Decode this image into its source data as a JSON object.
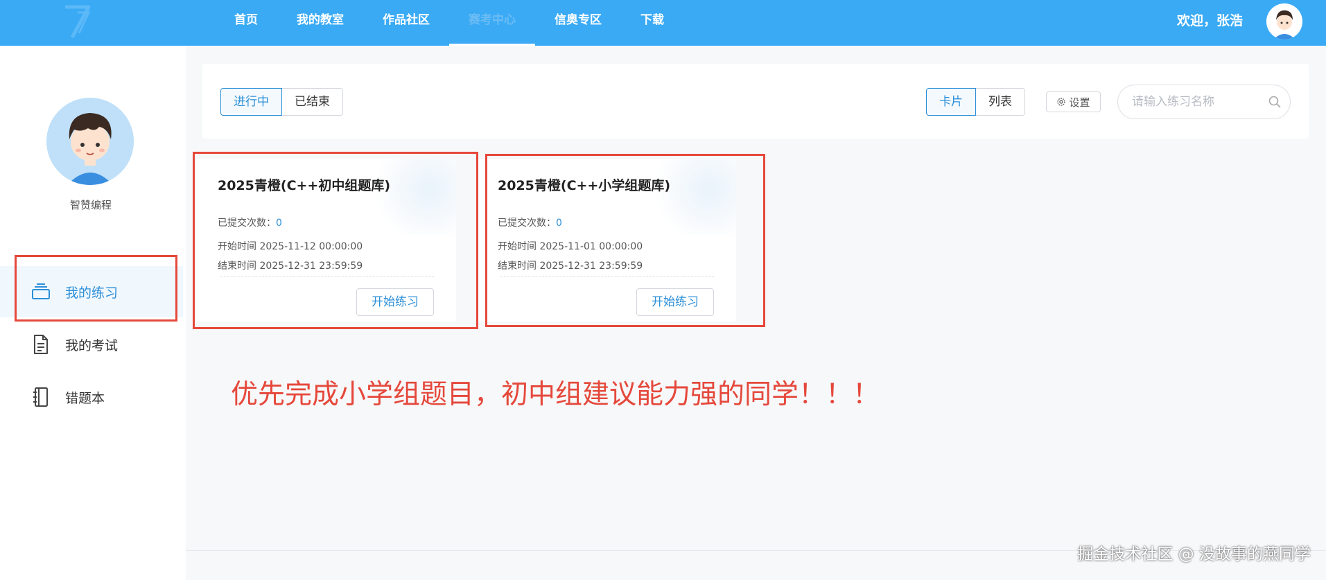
{
  "nav": {
    "items": [
      {
        "label": "首页",
        "active": false
      },
      {
        "label": "我的教室",
        "active": false
      },
      {
        "label": "作品社区",
        "active": false
      },
      {
        "label": "赛考中心",
        "active": true
      },
      {
        "label": "信奥专区",
        "active": false
      },
      {
        "label": "下载",
        "active": false
      }
    ],
    "welcome": "欢迎，张浩"
  },
  "sidebar": {
    "name": "智赞编程",
    "menu": [
      {
        "label": "我的练习",
        "icon": "stack-icon",
        "active": true
      },
      {
        "label": "我的考试",
        "icon": "document-icon",
        "active": false
      },
      {
        "label": "错题本",
        "icon": "notebook-icon",
        "active": false
      }
    ]
  },
  "toolbar": {
    "status_tabs": [
      "进行中",
      "已结束"
    ],
    "view_tabs": [
      "卡片",
      "列表"
    ],
    "settings_label": "设置",
    "search_placeholder": "请输入练习名称"
  },
  "cards": [
    {
      "title": "2025青橙(C++初中组题库)",
      "submit_label": "已提交次数：",
      "submit_count": "0",
      "start": "开始时间 2025-11-12 00:00:00",
      "end": "结束时间 2025-12-31 23:59:59",
      "button": "开始练习"
    },
    {
      "title": "2025青橙(C++小学组题库)",
      "submit_label": "已提交次数：",
      "submit_count": "0",
      "start": "开始时间 2025-11-01 00:00:00",
      "end": "结束时间 2025-12-31 23:59:59",
      "button": "开始练习"
    }
  ],
  "note": "优先完成小学组题目，初中组建议能力强的同学！！！",
  "watermark": "掘金技术社区 @ 没故事的燕同学",
  "colors": {
    "topbar": "#3aaaf5",
    "accent": "#2b8fd8",
    "annotation_red": "#e5483b"
  }
}
